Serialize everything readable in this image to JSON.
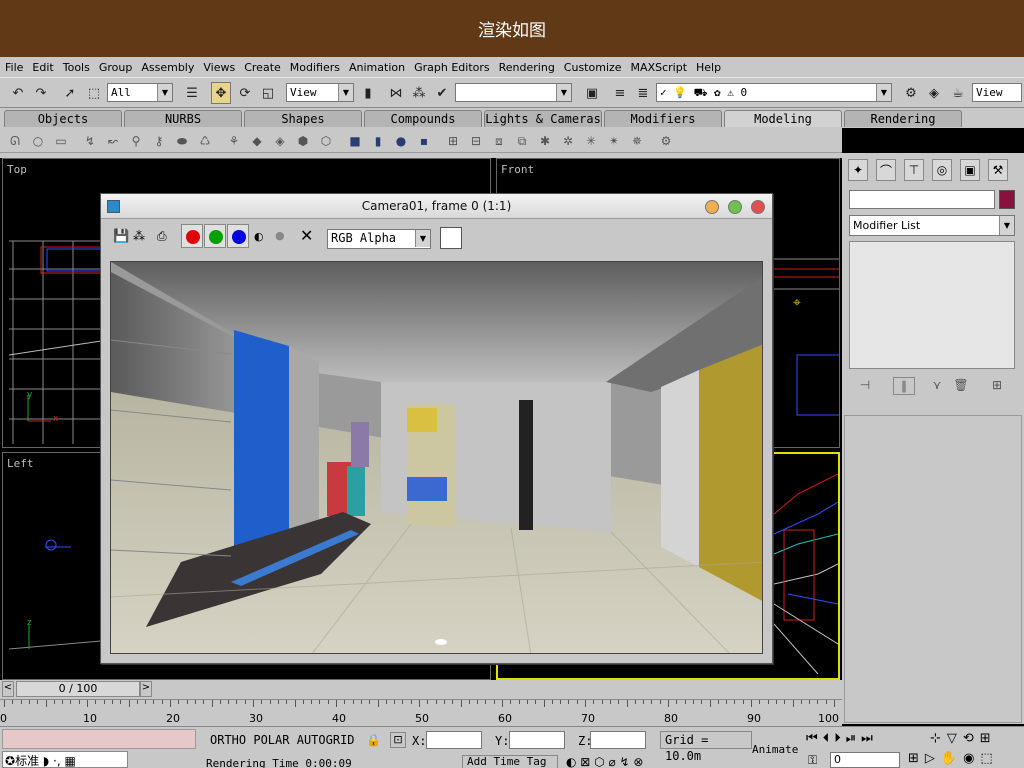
{
  "title_bar": {
    "text": "渲染如图"
  },
  "menu": {
    "items": [
      "File",
      "Edit",
      "Tools",
      "Group",
      "Assembly",
      "Views",
      "Create",
      "Modifiers",
      "Animation",
      "Graph Editors",
      "Rendering",
      "Customize",
      "MAXScript",
      "Help"
    ]
  },
  "toolbar": {
    "selection_filter": "All",
    "ref_coord": "View",
    "named_selection": "",
    "layer_value": "0",
    "view_right": "View"
  },
  "tabs": [
    "Objects",
    "NURBS",
    "Shapes",
    "Compounds",
    "Lights & Cameras",
    "Modifiers",
    "Modeling",
    "Rendering"
  ],
  "active_tab": "Modeling",
  "viewports": {
    "top": "Top",
    "front": "Front",
    "left": "Left"
  },
  "render_window": {
    "title": "Camera01, frame 0 (1:1)",
    "channel": "RGB Alpha",
    "colors": {
      "red": "#e00000",
      "green": "#00a000",
      "blue": "#0000e0"
    }
  },
  "command_panel": {
    "modifier_list": "Modifier List",
    "name_field": "",
    "object_color": "#8a1040"
  },
  "time_slider": {
    "label": "0 / 100"
  },
  "ruler": {
    "ticks": [
      "0",
      "10",
      "20",
      "30",
      "40",
      "50",
      "60",
      "70",
      "80",
      "90",
      "100"
    ]
  },
  "status": {
    "ortho": "ORTHO",
    "polar": "POLAR",
    "autogrid": "AUTOGRID",
    "x_label": "X:",
    "y_label": "Y:",
    "z_label": "Z:",
    "grid": "Grid = 10.0m",
    "animate": "Animate",
    "render_time": "Rendering Time  0:00:09",
    "add_time_tag": "Add Time Tag",
    "frame_field": "0",
    "ime_label": "标准"
  }
}
